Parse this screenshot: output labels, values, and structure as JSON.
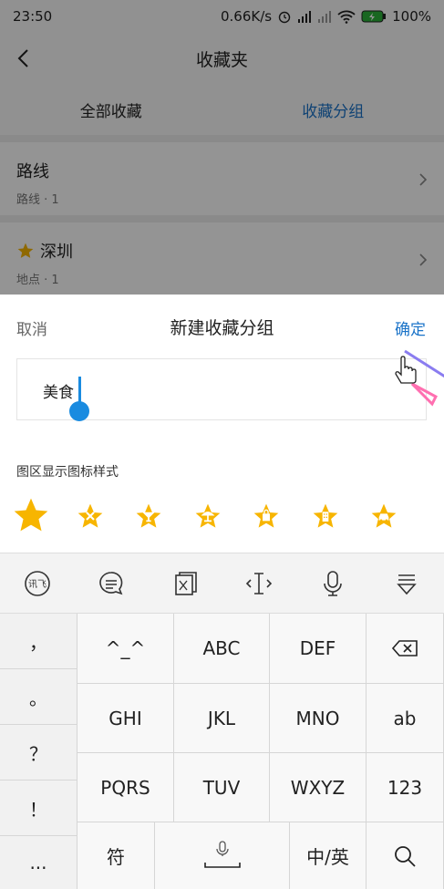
{
  "status_bar": {
    "time": "23:50",
    "speed": "0.66K/s",
    "battery": "100%"
  },
  "header": {
    "title": "收藏夹"
  },
  "tabs": [
    {
      "label": "全部收藏"
    },
    {
      "label": "收藏分组"
    }
  ],
  "list": [
    {
      "title": "路线",
      "subtitle": "路线 · 1"
    },
    {
      "title": "深圳",
      "subtitle": "地点 · 1"
    }
  ],
  "sheet": {
    "cancel": "取消",
    "title": "新建收藏分组",
    "confirm": "确定",
    "input_value": "美食",
    "style_label": "图区显示图标样式",
    "icons": [
      "star-icon",
      "food-icon",
      "cocktail-icon",
      "beach-icon",
      "shopping-bag-icon",
      "building-icon",
      "car-icon"
    ]
  },
  "keyboard": {
    "toolbar": [
      "voice-input-icon",
      "chat-icon",
      "clipboard-icon",
      "cursor-move-icon",
      "microphone-icon",
      "hide-keyboard-icon"
    ],
    "left_symbols": [
      "，",
      "。",
      "？",
      "！",
      "..."
    ],
    "row1": [
      "^_^",
      "ABC",
      "DEF"
    ],
    "row2": [
      "GHI",
      "JKL",
      "MNO",
      "ab"
    ],
    "row3": [
      "PQRS",
      "TUV",
      "WXYZ",
      "123"
    ],
    "row4": {
      "symbol": "符",
      "lang": "中/英"
    }
  },
  "colors": {
    "accent": "#1a73c8",
    "star": "#f7b500",
    "caret": "#1a8be0"
  }
}
